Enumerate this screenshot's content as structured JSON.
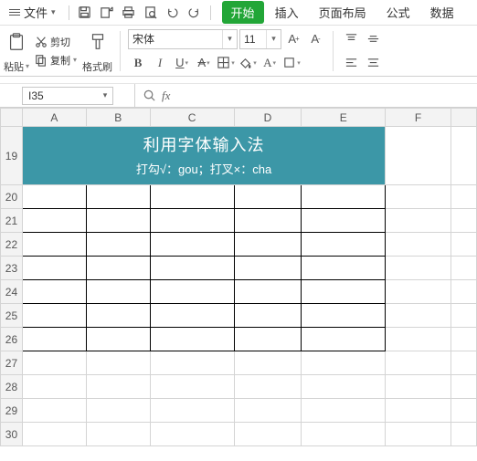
{
  "menubar": {
    "file_label": "文件",
    "qat": {
      "save": "save-icon",
      "print": "print-icon",
      "preview": "print-preview-icon",
      "undo": "undo-icon",
      "redo": "redo-icon"
    }
  },
  "tabs": {
    "start": "开始",
    "insert": "插入",
    "layout": "页面布局",
    "formula": "公式",
    "data": "数据"
  },
  "ribbon": {
    "paste": "粘贴",
    "cut": "剪切",
    "copy": "复制",
    "format_painter": "格式刷",
    "font_name": "宋体",
    "font_size": "11",
    "bold": "B",
    "italic": "I",
    "underline": "U",
    "increase_font": "A",
    "decrease_font": "A"
  },
  "namebox": {
    "value": "I35"
  },
  "fx": {
    "label": "fx"
  },
  "columns": [
    "A",
    "B",
    "C",
    "D",
    "E",
    "F"
  ],
  "rows": [
    "19",
    "20",
    "21",
    "22",
    "23",
    "24",
    "25",
    "26",
    "27",
    "28",
    "29",
    "30"
  ],
  "header_cell": {
    "title": "利用字体输入法",
    "subtitle": "打勾√：gou；打叉×：cha"
  }
}
